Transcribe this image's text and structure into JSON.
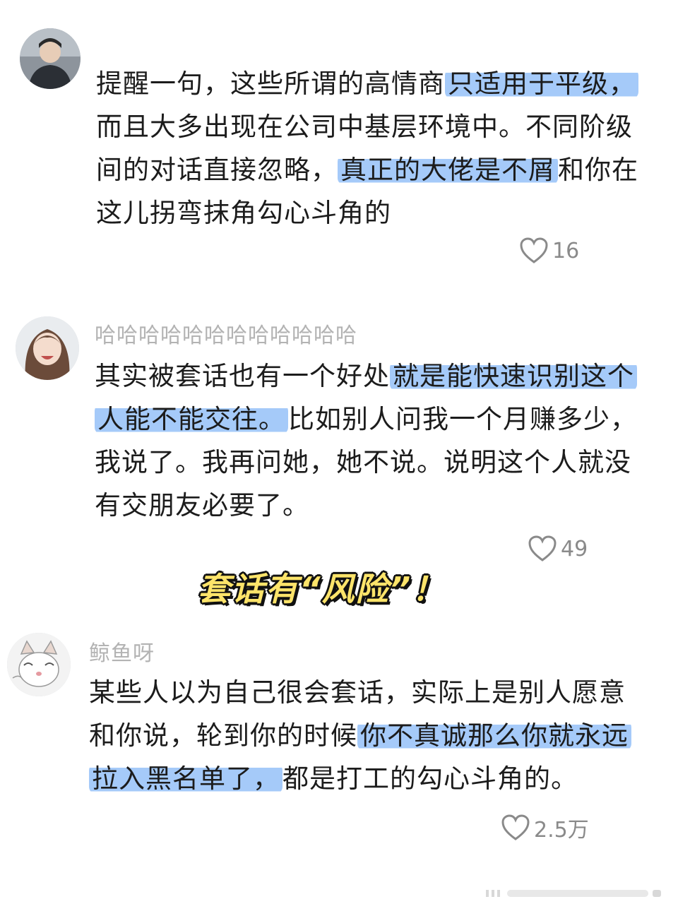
{
  "comments": [
    {
      "username": "",
      "avatar_icon": "avatar-man-icon",
      "lines": [
        [
          {
            "t": "提醒一句，这些所谓的高情商"
          },
          {
            "t": "只适用于平级，",
            "hl": true
          }
        ],
        [
          {
            "t": "而且大多出现在公司中基层环境中。不同阶级"
          }
        ],
        [
          {
            "t": "间的对话直接忽略，"
          },
          {
            "t": "真正的大佬是不屑",
            "hl": true
          },
          {
            "t": "和你在"
          }
        ],
        [
          {
            "t": "这儿拐弯抹角勾心斗角的"
          }
        ]
      ],
      "likes": "16"
    },
    {
      "username": "哈哈哈哈哈哈哈哈哈哈哈哈",
      "avatar_icon": "avatar-girl-icon",
      "lines": [
        [
          {
            "t": "其实被套话也有一个好处"
          },
          {
            "t": "就是能快速识别这个",
            "hl": true
          }
        ],
        [
          {
            "t": "人能不能交往。",
            "hl": true
          },
          {
            "t": "比如别人问我一个月赚多少，"
          }
        ],
        [
          {
            "t": "我说了。我再问她，她不说。说明这个人就没"
          }
        ],
        [
          {
            "t": "有交朋友必要了。"
          }
        ]
      ],
      "likes": "49"
    },
    {
      "username": "鲸鱼呀",
      "avatar_icon": "avatar-cat-icon",
      "lines": [
        [
          {
            "t": "某些人以为自己很会套话，实际上是别人愿意"
          }
        ],
        [
          {
            "t": "和你说，轮到你的时候"
          },
          {
            "t": "你不真诚那么你就永远",
            "hl": true
          }
        ],
        [
          {
            "t": "拉入黑名单了，",
            "hl": true
          },
          {
            "t": "都是打工的勾心斗角的。"
          }
        ]
      ],
      "likes": "2.5万"
    }
  ],
  "overlay_title": "套话有“风险”！",
  "colors": {
    "highlight": "#6eaaf5",
    "overlay_fill": "#fde46a",
    "muted": "#b3b3b3",
    "text": "#1c1c1c"
  },
  "icons": {
    "like": "heart-outline-icon"
  }
}
